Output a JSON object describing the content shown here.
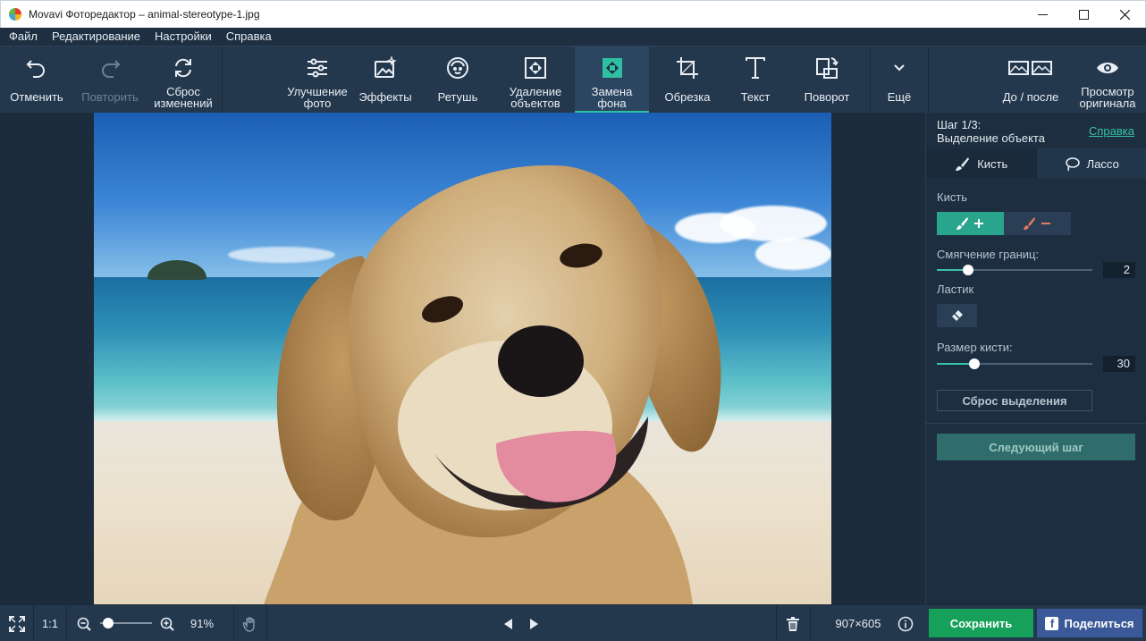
{
  "window": {
    "title": "Movavi Фоторедактор – animal-stereotype-1.jpg",
    "controls": [
      "minimize",
      "maximize",
      "close"
    ]
  },
  "menu": [
    "Файл",
    "Редактирование",
    "Настройки",
    "Справка"
  ],
  "toolbar": {
    "undo": "Отменить",
    "redo": "Повторить",
    "reset": "Сброс\nизменений",
    "enhance": "Улучшение\nфото",
    "effects": "Эффекты",
    "retouch": "Ретушь",
    "remove_objects": "Удаление\nобъектов",
    "replace_bg": "Замена\nфона",
    "crop": "Обрезка",
    "text": "Текст",
    "rotate": "Поворот",
    "more": "Ещё",
    "before_after": "До / после",
    "view_original": "Просмотр\nоригинала",
    "active_tool": "replace_bg",
    "disabled_tools": [
      "redo"
    ]
  },
  "panel": {
    "step_line1": "Шаг 1/3:",
    "step_line2": "Выделение объекта",
    "help_link": "Справка",
    "tabs": [
      {
        "label": "Кисть",
        "icon": "brush-icon",
        "active": true
      },
      {
        "label": "Лассо",
        "icon": "lasso-icon",
        "active": false
      }
    ],
    "brush_label": "Кисть",
    "brush_modes": [
      {
        "icon": "brush-plus-icon",
        "selected": true
      },
      {
        "icon": "brush-minus-icon",
        "selected": false
      }
    ],
    "feather_label": "Смягчение границ:",
    "feather_value": "2",
    "feather_level": 0.2,
    "eraser_label": "Ластик",
    "brush_size_label": "Размер кисти:",
    "brush_size_value": "30",
    "brush_size_level": 0.24,
    "reset_selection": "Сброс выделения",
    "next_step": "Следующий шаг"
  },
  "statusbar": {
    "fit_icon": "fit-screen-icon",
    "actual_size": "1:1",
    "zoom_percent": "91%",
    "zoom_level": 0.15,
    "dimensions": "907×605",
    "save": "Сохранить",
    "share": "Поделиться"
  },
  "colors": {
    "accent": "#2fbfa3",
    "save": "#16a05a",
    "share": "#3b5998",
    "toolbar_bg": "#24384d",
    "panel_bg": "#1d2e40"
  }
}
